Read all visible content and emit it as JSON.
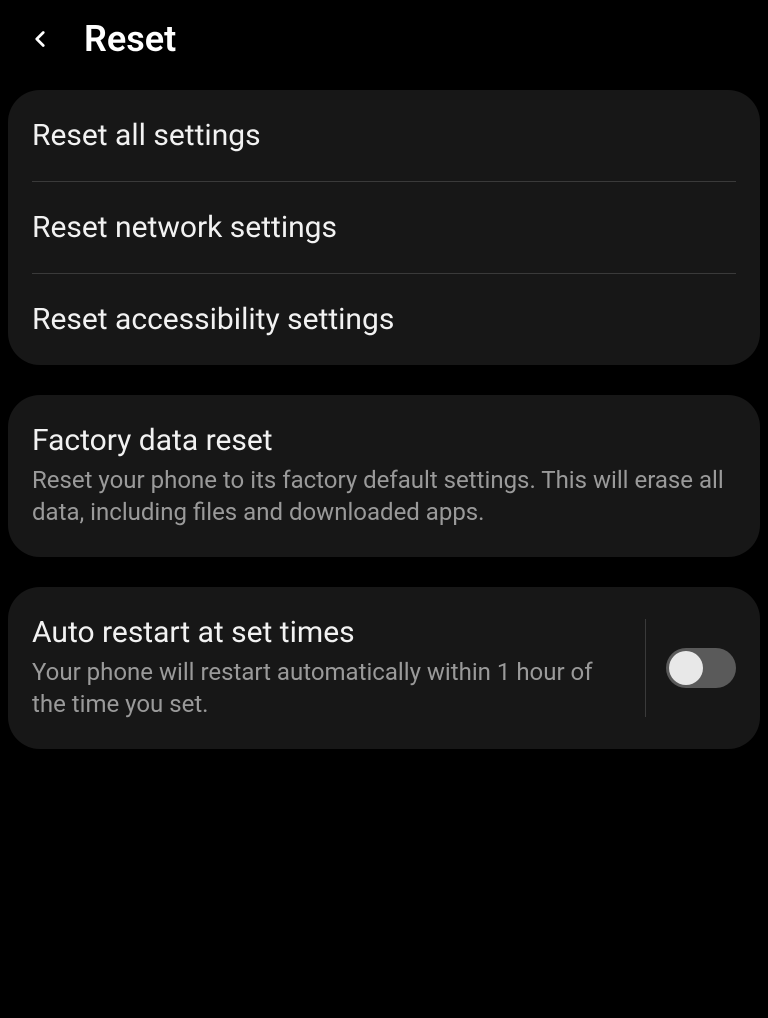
{
  "header": {
    "title": "Reset"
  },
  "group1": {
    "items": [
      {
        "title": "Reset all settings"
      },
      {
        "title": "Reset network settings"
      },
      {
        "title": "Reset accessibility settings"
      }
    ]
  },
  "group2": {
    "title": "Factory data reset",
    "description": "Reset your phone to its factory default settings. This will erase all data, including files and downloaded apps."
  },
  "group3": {
    "title": "Auto restart at set times",
    "description": "Your phone will restart automatically within 1 hour of the time you set.",
    "toggle_on": false
  }
}
